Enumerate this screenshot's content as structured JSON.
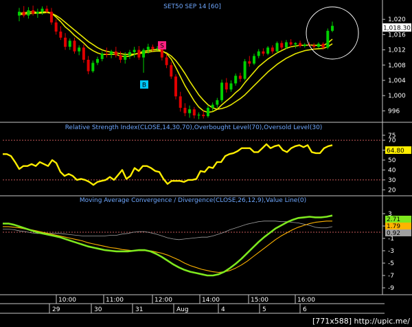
{
  "chart_data": [
    {
      "type": "candlestick",
      "title": "SET50 SEP 14   [60]",
      "ylim": [
        993,
        1024
      ],
      "y_ticks": [
        996,
        1000,
        1004,
        1008,
        1012,
        1016,
        1020
      ],
      "last_value_label": "1,018.30",
      "last_value": 1018.3,
      "colors": {
        "up": "#00d000",
        "down": "#e00000",
        "ma_fast": "#e8e800",
        "ma_slow": "#e8e800"
      },
      "candles": [
        {
          "o": 1021.0,
          "h": 1023.0,
          "l": 1019.5,
          "c": 1022.0
        },
        {
          "o": 1022.0,
          "h": 1023.5,
          "l": 1020.5,
          "c": 1021.0
        },
        {
          "o": 1021.0,
          "h": 1023.2,
          "l": 1020.2,
          "c": 1022.4
        },
        {
          "o": 1022.4,
          "h": 1023.6,
          "l": 1021.0,
          "c": 1021.5
        },
        {
          "o": 1021.5,
          "h": 1022.8,
          "l": 1020.4,
          "c": 1022.0
        },
        {
          "o": 1022.0,
          "h": 1023.4,
          "l": 1021.2,
          "c": 1022.8
        },
        {
          "o": 1022.8,
          "h": 1023.6,
          "l": 1021.6,
          "c": 1022.0
        },
        {
          "o": 1022.0,
          "h": 1023.0,
          "l": 1018.6,
          "c": 1019.2
        },
        {
          "o": 1019.2,
          "h": 1020.0,
          "l": 1016.0,
          "c": 1016.8
        },
        {
          "o": 1016.8,
          "h": 1018.2,
          "l": 1014.6,
          "c": 1015.2
        },
        {
          "o": 1015.2,
          "h": 1016.4,
          "l": 1012.0,
          "c": 1012.8
        },
        {
          "o": 1012.8,
          "h": 1015.0,
          "l": 1012.0,
          "c": 1014.4
        },
        {
          "o": 1014.4,
          "h": 1015.2,
          "l": 1011.0,
          "c": 1011.6
        },
        {
          "o": 1011.6,
          "h": 1013.2,
          "l": 1010.6,
          "c": 1012.6
        },
        {
          "o": 1012.6,
          "h": 1013.4,
          "l": 1008.6,
          "c": 1009.4
        },
        {
          "o": 1009.4,
          "h": 1010.4,
          "l": 1005.6,
          "c": 1006.4
        },
        {
          "o": 1006.4,
          "h": 1009.2,
          "l": 1006.0,
          "c": 1008.6
        },
        {
          "o": 1008.6,
          "h": 1010.2,
          "l": 1008.0,
          "c": 1009.6
        },
        {
          "o": 1009.6,
          "h": 1011.6,
          "l": 1009.0,
          "c": 1011.0
        },
        {
          "o": 1011.0,
          "h": 1012.6,
          "l": 1010.0,
          "c": 1010.8
        },
        {
          "o": 1010.8,
          "h": 1012.0,
          "l": 1009.8,
          "c": 1011.6
        },
        {
          "o": 1011.6,
          "h": 1012.8,
          "l": 1010.0,
          "c": 1010.6
        },
        {
          "o": 1010.6,
          "h": 1011.6,
          "l": 1008.6,
          "c": 1009.4
        },
        {
          "o": 1009.4,
          "h": 1011.4,
          "l": 1008.4,
          "c": 1010.6
        },
        {
          "o": 1010.6,
          "h": 1012.0,
          "l": 1009.6,
          "c": 1011.4
        },
        {
          "o": 1011.4,
          "h": 1012.8,
          "l": 1010.0,
          "c": 1012.0
        },
        {
          "o": 1012.0,
          "h": 1013.0,
          "l": 1009.4,
          "c": 1010.0
        },
        {
          "o": 1010.0,
          "h": 1012.4,
          "l": 1006.0,
          "c": 1012.0
        },
        {
          "o": 1012.0,
          "h": 1013.6,
          "l": 1011.0,
          "c": 1012.8
        },
        {
          "o": 1012.8,
          "h": 1013.4,
          "l": 1011.6,
          "c": 1012.2
        },
        {
          "o": 1012.2,
          "h": 1013.0,
          "l": 1011.8,
          "c": 1012.4
        },
        {
          "o": 1012.4,
          "h": 1013.2,
          "l": 1009.2,
          "c": 1010.0
        },
        {
          "o": 1010.0,
          "h": 1011.0,
          "l": 1007.2,
          "c": 1008.0
        },
        {
          "o": 1008.0,
          "h": 1008.8,
          "l": 1004.4,
          "c": 1005.0
        },
        {
          "o": 1005.0,
          "h": 1005.6,
          "l": 999.0,
          "c": 999.8
        },
        {
          "o": 999.8,
          "h": 1001.0,
          "l": 995.8,
          "c": 996.8
        },
        {
          "o": 996.8,
          "h": 998.0,
          "l": 994.6,
          "c": 995.4
        },
        {
          "o": 995.4,
          "h": 997.4,
          "l": 994.2,
          "c": 996.4
        },
        {
          "o": 996.4,
          "h": 997.0,
          "l": 994.0,
          "c": 994.8
        },
        {
          "o": 994.8,
          "h": 995.6,
          "l": 993.8,
          "c": 995.0
        },
        {
          "o": 995.0,
          "h": 996.0,
          "l": 994.0,
          "c": 994.6
        },
        {
          "o": 994.6,
          "h": 997.4,
          "l": 994.2,
          "c": 996.8
        },
        {
          "o": 996.8,
          "h": 998.2,
          "l": 996.0,
          "c": 997.6
        },
        {
          "o": 997.6,
          "h": 999.4,
          "l": 996.8,
          "c": 998.8
        },
        {
          "o": 998.8,
          "h": 1004.2,
          "l": 998.2,
          "c": 1003.4
        },
        {
          "o": 1003.4,
          "h": 1004.6,
          "l": 1000.8,
          "c": 1001.6
        },
        {
          "o": 1001.6,
          "h": 1004.0,
          "l": 1001.0,
          "c": 1003.2
        },
        {
          "o": 1003.2,
          "h": 1005.8,
          "l": 1002.6,
          "c": 1005.2
        },
        {
          "o": 1005.2,
          "h": 1006.0,
          "l": 1003.6,
          "c": 1004.4
        },
        {
          "o": 1004.4,
          "h": 1009.6,
          "l": 1004.0,
          "c": 1009.0
        },
        {
          "o": 1009.0,
          "h": 1010.4,
          "l": 1007.6,
          "c": 1008.4
        },
        {
          "o": 1008.4,
          "h": 1011.0,
          "l": 1008.0,
          "c": 1010.4
        },
        {
          "o": 1010.4,
          "h": 1012.2,
          "l": 1009.8,
          "c": 1011.6
        },
        {
          "o": 1011.6,
          "h": 1012.4,
          "l": 1010.4,
          "c": 1011.0
        },
        {
          "o": 1011.0,
          "h": 1013.0,
          "l": 1010.6,
          "c": 1012.6
        },
        {
          "o": 1012.6,
          "h": 1013.2,
          "l": 1011.0,
          "c": 1011.6
        },
        {
          "o": 1011.6,
          "h": 1014.2,
          "l": 1011.2,
          "c": 1013.8
        },
        {
          "o": 1013.8,
          "h": 1014.4,
          "l": 1012.0,
          "c": 1012.6
        },
        {
          "o": 1012.6,
          "h": 1014.6,
          "l": 1012.2,
          "c": 1014.0
        },
        {
          "o": 1014.0,
          "h": 1014.8,
          "l": 1012.8,
          "c": 1013.4
        },
        {
          "o": 1013.4,
          "h": 1014.0,
          "l": 1012.4,
          "c": 1013.8
        },
        {
          "o": 1013.8,
          "h": 1014.4,
          "l": 1012.6,
          "c": 1013.0
        },
        {
          "o": 1013.0,
          "h": 1013.8,
          "l": 1012.6,
          "c": 1013.4
        },
        {
          "o": 1013.4,
          "h": 1014.0,
          "l": 1012.8,
          "c": 1013.2
        },
        {
          "o": 1013.2,
          "h": 1013.8,
          "l": 1012.2,
          "c": 1012.8
        },
        {
          "o": 1012.8,
          "h": 1014.0,
          "l": 1012.4,
          "c": 1013.6
        },
        {
          "o": 1013.6,
          "h": 1014.0,
          "l": 1012.0,
          "c": 1012.6
        },
        {
          "o": 1012.6,
          "h": 1017.6,
          "l": 1012.2,
          "c": 1017.0
        },
        {
          "o": 1017.0,
          "h": 1019.4,
          "l": 1016.6,
          "c": 1018.3
        }
      ],
      "ma_fast": [
        1021.6,
        1021.7,
        1021.9,
        1022.0,
        1021.8,
        1021.9,
        1022.0,
        1021.6,
        1020.6,
        1019.4,
        1018.0,
        1017.0,
        1015.8,
        1014.8,
        1013.8,
        1012.6,
        1011.8,
        1011.2,
        1010.8,
        1010.8,
        1010.8,
        1010.8,
        1010.4,
        1010.2,
        1010.4,
        1010.8,
        1011.2,
        1011.6,
        1011.8,
        1012.0,
        1012.1,
        1011.8,
        1011.0,
        1009.6,
        1007.4,
        1005.0,
        1002.6,
        1000.6,
        998.6,
        997.0,
        996.0,
        995.6,
        995.8,
        996.4,
        997.6,
        998.6,
        999.6,
        1000.8,
        1001.8,
        1003.4,
        1004.8,
        1006.2,
        1007.6,
        1008.6,
        1009.6,
        1010.4,
        1011.2,
        1011.8,
        1012.4,
        1012.8,
        1013.0,
        1013.2,
        1013.2,
        1013.3,
        1013.2,
        1013.2,
        1013.1,
        1013.8,
        1014.8
      ],
      "ma_slow": [
        1021.2,
        1021.4,
        1021.5,
        1021.6,
        1021.6,
        1021.7,
        1021.8,
        1021.6,
        1021.0,
        1020.2,
        1019.2,
        1018.2,
        1017.2,
        1016.2,
        1015.2,
        1014.2,
        1013.4,
        1012.6,
        1012.0,
        1011.6,
        1011.4,
        1011.2,
        1011.0,
        1010.8,
        1010.8,
        1010.9,
        1011.0,
        1011.2,
        1011.4,
        1011.6,
        1011.7,
        1011.6,
        1011.2,
        1010.4,
        1009.2,
        1007.6,
        1005.8,
        1003.8,
        1002.0,
        1000.2,
        998.8,
        997.6,
        996.8,
        996.4,
        996.6,
        997.0,
        997.6,
        998.4,
        999.2,
        1000.2,
        1001.4,
        1002.6,
        1003.8,
        1005.0,
        1006.2,
        1007.2,
        1008.2,
        1009.0,
        1009.8,
        1010.4,
        1011.0,
        1011.4,
        1011.8,
        1012.0,
        1012.2,
        1012.3,
        1012.4,
        1012.8,
        1013.6
      ]
    },
    {
      "type": "line",
      "title": "Relative Strength Index(CLOSE,14,30,70),Overbought Level(70),Oversold Level(30)",
      "ylim": [
        14,
        77
      ],
      "y_ticks": [
        20,
        30,
        40,
        50,
        60,
        70,
        75
      ],
      "overbought": 70,
      "oversold": 30,
      "last_value_label": "64.80",
      "last_value": 64.8,
      "colors": {
        "line": "#ffee00",
        "levels": "#c85a5a"
      },
      "values": [
        56,
        56,
        54,
        48,
        41,
        44,
        44,
        46,
        44,
        48,
        46,
        44,
        50,
        47,
        38,
        34,
        36,
        34,
        30,
        31,
        30,
        28,
        25,
        28,
        29,
        30,
        33,
        30,
        35,
        40,
        31,
        34,
        42,
        39,
        44,
        44,
        42,
        39,
        38,
        31,
        26,
        29,
        29,
        29,
        28,
        30,
        30,
        31,
        39,
        38,
        43,
        42,
        48,
        48,
        54,
        56,
        57,
        59,
        62,
        62,
        62,
        58,
        58,
        62,
        66,
        62,
        64,
        65,
        60,
        58,
        62,
        64,
        65,
        63,
        65,
        58,
        57,
        57,
        62,
        64,
        65
      ]
    },
    {
      "type": "line",
      "title": "Moving Average Convergence / Divergence(CLOSE,26,12,9),Value Line(0)",
      "ylim": [
        -10,
        4
      ],
      "y_ticks": [
        -9,
        -7,
        -5,
        -3,
        -1,
        1,
        3
      ],
      "zero_line": 0,
      "last_value_labels": [
        "2.71",
        "1.79",
        "0.92"
      ],
      "last_values": [
        2.71,
        1.79,
        0.92
      ],
      "colors": {
        "macd": "#7ee81e",
        "signal": "#ffb400",
        "histogram": "#a0a0a0",
        "value_line": "#c85a5a"
      },
      "macd": [
        1.4,
        1.4,
        1.2,
        0.9,
        0.6,
        0.3,
        0.0,
        -0.2,
        -0.4,
        -0.6,
        -0.8,
        -1.1,
        -1.4,
        -1.7,
        -2.0,
        -2.3,
        -2.5,
        -2.7,
        -2.9,
        -3.0,
        -3.1,
        -3.1,
        -3.1,
        -3.0,
        -2.9,
        -2.9,
        -3.1,
        -3.5,
        -4.0,
        -4.6,
        -5.2,
        -5.7,
        -6.1,
        -6.4,
        -6.6,
        -6.8,
        -7.0,
        -7.0,
        -6.8,
        -6.4,
        -5.8,
        -5.1,
        -4.3,
        -3.4,
        -2.5,
        -1.6,
        -0.8,
        -0.1,
        0.6,
        1.1,
        1.6,
        2.0,
        2.3,
        2.4,
        2.5,
        2.4,
        2.4,
        2.5,
        2.7
      ],
      "signal": [
        0.9,
        0.9,
        0.8,
        0.7,
        0.5,
        0.4,
        0.2,
        0.0,
        -0.2,
        -0.4,
        -0.6,
        -0.8,
        -1.0,
        -1.2,
        -1.4,
        -1.7,
        -1.9,
        -2.1,
        -2.3,
        -2.5,
        -2.6,
        -2.8,
        -2.9,
        -3.0,
        -3.0,
        -3.0,
        -3.0,
        -3.2,
        -3.4,
        -3.7,
        -4.1,
        -4.5,
        -5.0,
        -5.4,
        -5.7,
        -6.0,
        -6.2,
        -6.4,
        -6.5,
        -6.4,
        -6.2,
        -5.8,
        -5.3,
        -4.7,
        -4.0,
        -3.3,
        -2.6,
        -1.9,
        -1.2,
        -0.6,
        -0.1,
        0.4,
        0.8,
        1.1,
        1.4,
        1.6,
        1.7,
        1.8,
        1.8
      ],
      "histogram": [
        0.5,
        0.5,
        0.4,
        0.2,
        0.1,
        -0.1,
        -0.2,
        -0.2,
        -0.2,
        -0.2,
        -0.2,
        -0.3,
        -0.4,
        -0.5,
        -0.6,
        -0.6,
        -0.6,
        -0.6,
        -0.6,
        -0.5,
        -0.5,
        -0.3,
        -0.2,
        0.0,
        0.1,
        0.1,
        -0.1,
        -0.3,
        -0.6,
        -0.9,
        -1.1,
        -1.2,
        -1.1,
        -1.0,
        -0.9,
        -0.8,
        -0.8,
        -0.6,
        -0.3,
        0.0,
        0.4,
        0.7,
        1.0,
        1.3,
        1.5,
        1.7,
        1.8,
        1.8,
        1.8,
        1.7,
        1.7,
        1.6,
        1.5,
        1.3,
        1.1,
        0.8,
        0.7,
        0.7,
        0.9
      ]
    }
  ],
  "x_axis": {
    "time_labels": [
      "10:00",
      "11:00",
      "12:00",
      "14:00",
      "15:00",
      "16:00"
    ],
    "day_labels": [
      "29",
      "30",
      "31",
      "Aug",
      "4",
      "5",
      "6"
    ]
  },
  "signals": [
    {
      "label": "B",
      "color": "#00c8ff"
    },
    {
      "label": "S",
      "color": "#ff2080"
    }
  ],
  "watermark": "[771x588] http://upic.me/"
}
